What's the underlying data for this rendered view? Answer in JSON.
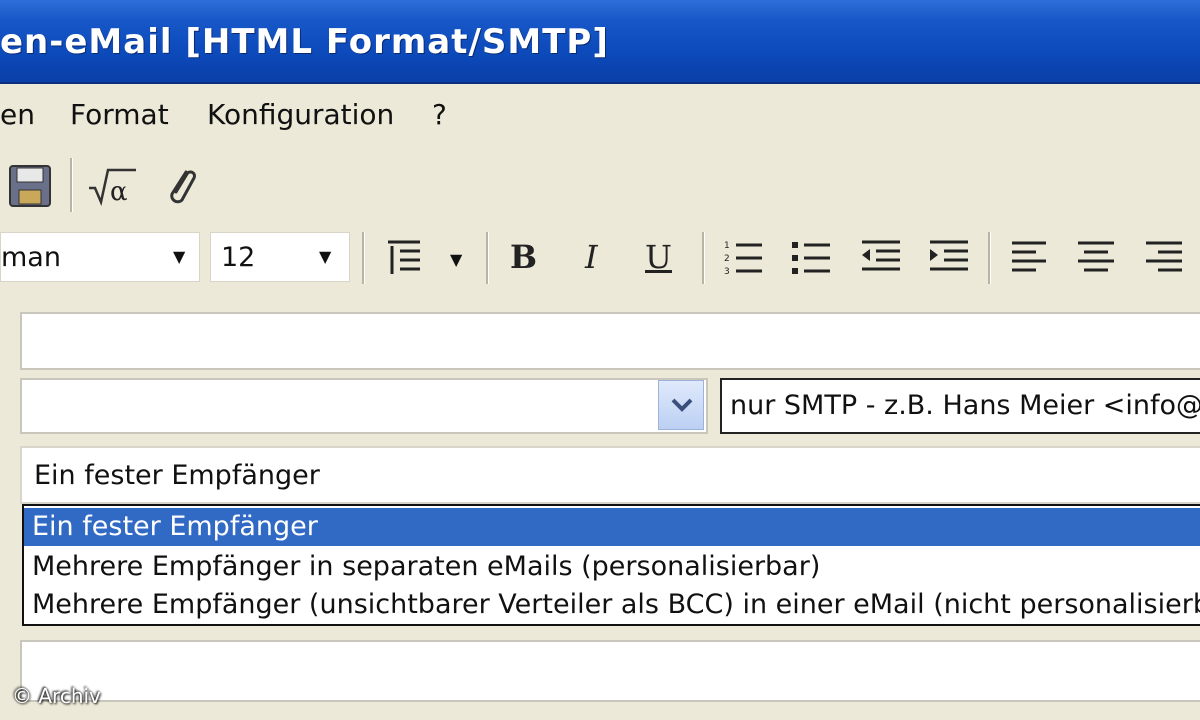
{
  "window": {
    "title": "en-eMail [HTML Format/SMTP]"
  },
  "menu": {
    "items": [
      "en",
      "Format",
      "Konfiguration",
      "?"
    ]
  },
  "toolbar": {
    "icons": [
      "save-icon",
      "formula-icon",
      "attachment-icon"
    ]
  },
  "format_bar": {
    "font_name": "man",
    "font_size": "12",
    "bold": "B",
    "italic": "I",
    "underline": "U"
  },
  "form": {
    "address_hint": "nur SMTP - z.B. Hans Meier <info@",
    "recipient_mode_value": "Ein fester Empfänger",
    "recipient_options": [
      "Ein fester Empfänger",
      "Mehrere Empfänger in separaten eMails (personalisierbar)",
      "Mehrere Empfänger (unsichtbarer Verteiler als BCC) in einer eMail (nicht personalisierba"
    ],
    "selected_option_index": 0
  },
  "watermark": {
    "text": "© Archiv"
  },
  "colors": {
    "titlebar": "#0d4bbd",
    "selection": "#316ac5",
    "chrome": "#ece9d8"
  }
}
